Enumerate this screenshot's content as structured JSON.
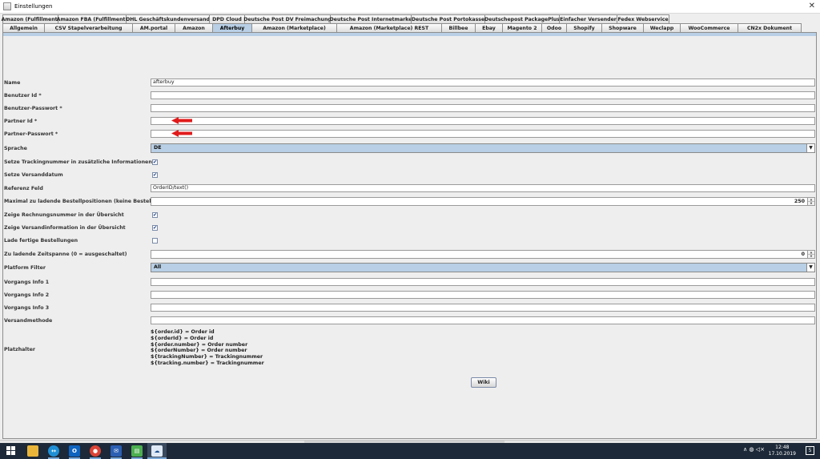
{
  "window": {
    "title": "Einstellungen",
    "close_glyph": "✕"
  },
  "tabs_row1": [
    {
      "label": "Amazon (Fulfillment)",
      "w": 70
    },
    {
      "label": "Amazon FBA (Fulfillment)",
      "w": 86
    },
    {
      "label": "DHL Geschäftskundenversand",
      "w": 105
    },
    {
      "label": "DPD Cloud",
      "w": 45
    },
    {
      "label": "Deutsche Post DV Freimachung",
      "w": 108
    },
    {
      "label": "Deutsche Post Internetmarke",
      "w": 102
    },
    {
      "label": "Deutsche Post Portokasse",
      "w": 93
    },
    {
      "label": "Deutschepost PackagePlus",
      "w": 94
    },
    {
      "label": "Einfacher Versender",
      "w": 73
    },
    {
      "label": "Fedex Webservice",
      "w": 66
    }
  ],
  "tabs_row2": [
    {
      "label": "Allgemein",
      "w": 53,
      "active": false
    },
    {
      "label": "CSV Stapelverarbeitung",
      "w": 111,
      "active": false
    },
    {
      "label": "AM.portal",
      "w": 54,
      "active": false
    },
    {
      "label": "Amazon",
      "w": 48,
      "active": false
    },
    {
      "label": "Afterbuy",
      "w": 50,
      "active": true
    },
    {
      "label": "Amazon (Marketplace)",
      "w": 107,
      "active": false
    },
    {
      "label": "Amazon (Marketplace) REST",
      "w": 132,
      "active": false
    },
    {
      "label": "Billbee",
      "w": 43,
      "active": false
    },
    {
      "label": "Ebay",
      "w": 35,
      "active": false
    },
    {
      "label": "Magento 2",
      "w": 50,
      "active": false
    },
    {
      "label": "Odoo",
      "w": 32,
      "active": false
    },
    {
      "label": "Shopify",
      "w": 45,
      "active": false
    },
    {
      "label": "Shopware",
      "w": 53,
      "active": false
    },
    {
      "label": "Weclapp",
      "w": 47,
      "active": false
    },
    {
      "label": "WooCommerce",
      "w": 73,
      "active": false
    },
    {
      "label": "CN2x Dokument",
      "w": 80,
      "active": false
    }
  ],
  "form": {
    "name_label": "Name",
    "name_value": "afterbuy",
    "benutzer_id_label": "Benutzer Id *",
    "benutzer_id_value": "",
    "benutzer_passwort_label": "Benutzer-Passwort *",
    "benutzer_passwort_value": "",
    "partner_id_label": "Partner Id *",
    "partner_id_value": "",
    "partner_passwort_label": "Partner-Passwort *",
    "partner_passwort_value": "",
    "sprache_label": "Sprache",
    "sprache_value": "DE",
    "setze_tracking_label": "Setze Trackingnummer in zusätzliche Informationen",
    "setze_tracking_checked": true,
    "setze_versanddatum_label": "Setze Versanddatum",
    "setze_versanddatum_checked": true,
    "referenz_feld_label": "Referenz Feld",
    "referenz_feld_value": "OrderID/text()",
    "max_positionen_label": "Maximal zu ladende Bestellpositionen (keine Bestellungen)",
    "max_positionen_value": "250",
    "zeige_rechnungsnummer_label": "Zeige Rechnungsnummer in der Übersicht",
    "zeige_rechnungsnummer_checked": true,
    "zeige_versandinfo_label": "Zeige Versandinformation in der Übersicht",
    "zeige_versandinfo_checked": true,
    "lade_fertige_label": "Lade fertige Bestellungen",
    "lade_fertige_checked": false,
    "zeitspanne_label": "Zu ladende Zeitspanne (0 = ausgeschaltet)",
    "zeitspanne_value": "0",
    "platform_filter_label": "Platform Filter",
    "platform_filter_value": "All",
    "vorgangs_info_1_label": "Vorgangs Info 1",
    "vorgangs_info_1_value": "",
    "vorgangs_info_2_label": "Vorgangs Info 2",
    "vorgangs_info_2_value": "",
    "vorgangs_info_3_label": "Vorgangs Info 3",
    "vorgangs_info_3_value": "",
    "versandmethode_label": "Versandmethode",
    "versandmethode_value": "",
    "platzhalter_label": "Platzhalter",
    "platzhalter_lines": [
      "${order.id} = Order id",
      "${orderId} = Order id",
      "${order.number} = Order number",
      "${orderNumber} = Order number",
      "${trackingNumber} = Trackingnummer",
      "${tracking.number} =  Trackingnummer"
    ],
    "wiki_button": "Wiki"
  },
  "annotation": {
    "arrow_color": "#e01b1b"
  },
  "taskbar": {
    "time": "12:48",
    "date": "17.10.2019",
    "tray_glyphs": "∧  ◍  ◁×",
    "notification_badge": "5"
  },
  "colors": {
    "active_tab": "#b8cfe5",
    "taskbar": "#1d2938"
  }
}
